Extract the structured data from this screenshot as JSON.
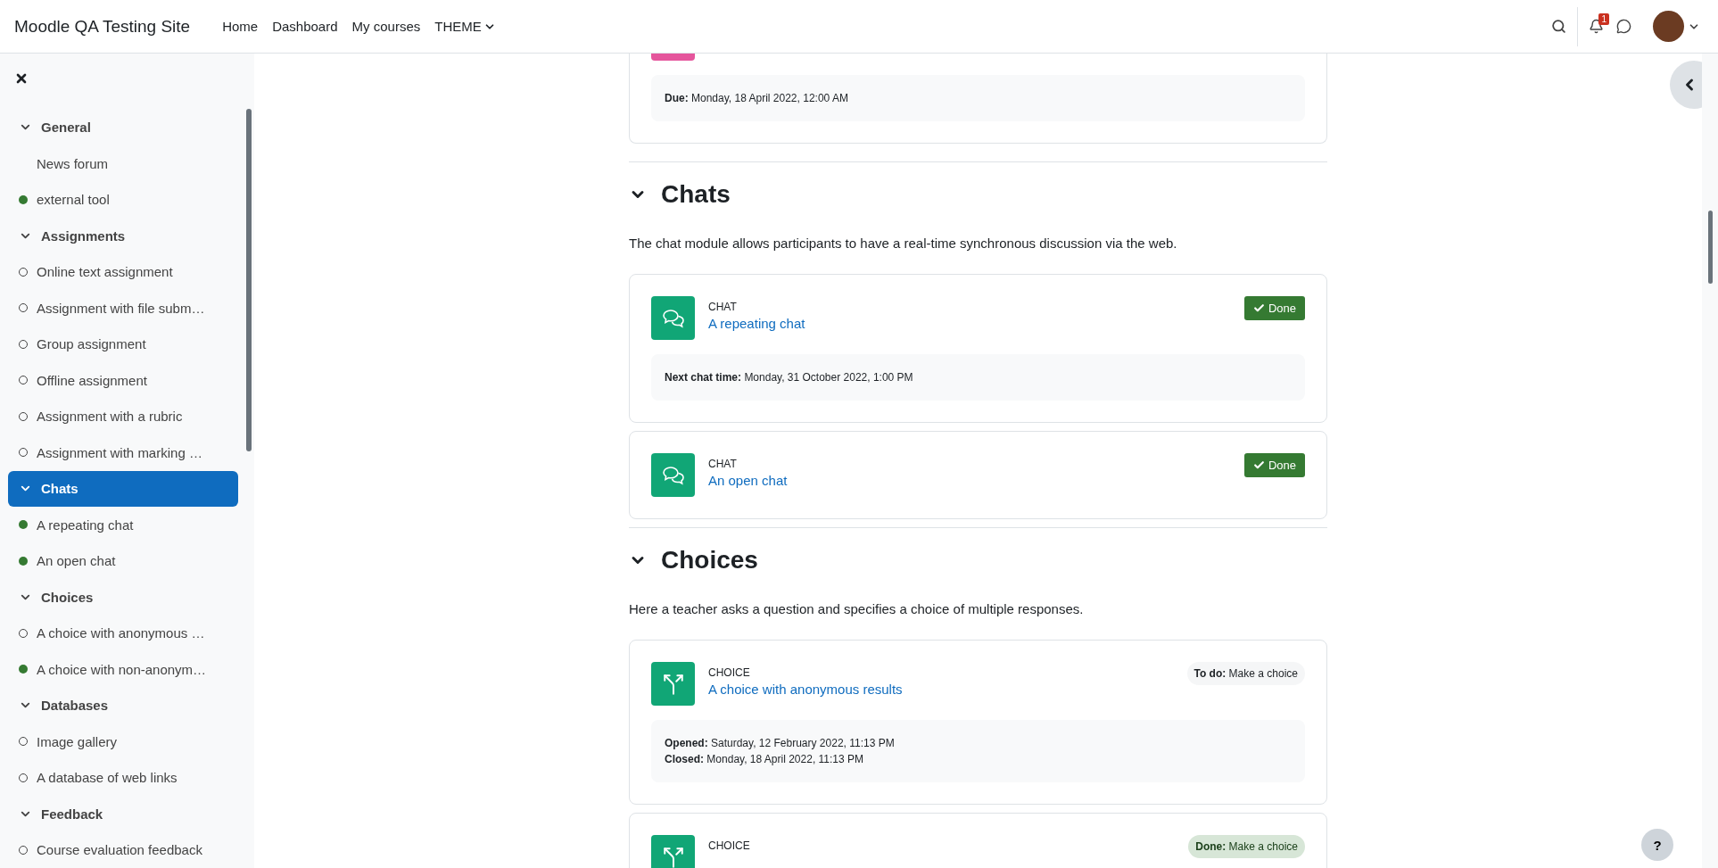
{
  "navbar": {
    "site_name": "Moodle QA Testing Site",
    "links": [
      {
        "label": "Home",
        "has_menu": false
      },
      {
        "label": "Dashboard",
        "has_menu": false
      },
      {
        "label": "My courses",
        "has_menu": false
      },
      {
        "label": "THEME",
        "has_menu": true
      }
    ],
    "notification_count": "1"
  },
  "drawer": {
    "sections": [
      {
        "label": "General",
        "expanded": true,
        "selected": false,
        "children": [
          {
            "label": "News forum",
            "kind": "untracked"
          },
          {
            "label": "external tool",
            "kind": "done"
          }
        ]
      },
      {
        "label": "Assignments",
        "expanded": true,
        "selected": false,
        "children": [
          {
            "label": "Online text assignment",
            "kind": "todo"
          },
          {
            "label": "Assignment with file subm…",
            "kind": "todo"
          },
          {
            "label": "Group assignment",
            "kind": "todo"
          },
          {
            "label": "Offline assignment",
            "kind": "todo"
          },
          {
            "label": "Assignment with a rubric",
            "kind": "todo"
          },
          {
            "label": "Assignment with marking …",
            "kind": "todo"
          }
        ]
      },
      {
        "label": "Chats",
        "expanded": true,
        "selected": true,
        "children": [
          {
            "label": "A repeating chat",
            "kind": "done"
          },
          {
            "label": "An open chat",
            "kind": "done"
          }
        ]
      },
      {
        "label": "Choices",
        "expanded": true,
        "selected": false,
        "children": [
          {
            "label": "A choice with anonymous …",
            "kind": "todo"
          },
          {
            "label": "A choice with non-anonym…",
            "kind": "done"
          }
        ]
      },
      {
        "label": "Databases",
        "expanded": true,
        "selected": false,
        "children": [
          {
            "label": "Image gallery",
            "kind": "todo"
          },
          {
            "label": "A database of web links",
            "kind": "todo"
          }
        ]
      },
      {
        "label": "Feedback",
        "expanded": true,
        "selected": false,
        "children": [
          {
            "label": "Course evaluation feedback",
            "kind": "todo"
          }
        ]
      }
    ]
  },
  "top_card": {
    "dates": [
      {
        "label": "Due:",
        "value": "Monday, 18 April 2022, 12:00 AM"
      }
    ]
  },
  "sections": [
    {
      "title": "Chats",
      "expanded": true,
      "description": "The chat module allows participants to have a real-time synchronous discussion via the web.",
      "activities": [
        {
          "kind": "chat",
          "type_label": "CHAT",
          "title": "A repeating chat",
          "status": {
            "kind": "manual_done",
            "label": "Done"
          },
          "dates": [
            {
              "label": "Next chat time:",
              "value": "Monday, 31 October 2022, 1:00 PM"
            }
          ]
        },
        {
          "kind": "chat",
          "type_label": "CHAT",
          "title": "An open chat",
          "status": {
            "kind": "manual_done",
            "label": "Done"
          }
        }
      ]
    },
    {
      "title": "Choices",
      "expanded": true,
      "description": "Here a teacher asks a question and specifies a choice of multiple responses.",
      "activities": [
        {
          "kind": "choice",
          "type_label": "CHOICE",
          "title": "A choice with anonymous results",
          "status": {
            "kind": "todo",
            "label": "**To do:** Make a choice"
          },
          "dates": [
            {
              "label": "Opened:",
              "value": "Saturday, 12 February 2022, 11:13 PM"
            },
            {
              "label": "Closed:",
              "value": "Monday, 18 April 2022, 11:13 PM"
            }
          ]
        },
        {
          "kind": "choice",
          "type_label": "CHOICE",
          "status": {
            "kind": "auto_done",
            "label": "**Done:** Make a choice"
          }
        }
      ]
    }
  ],
  "help_button": {
    "label": "?"
  }
}
